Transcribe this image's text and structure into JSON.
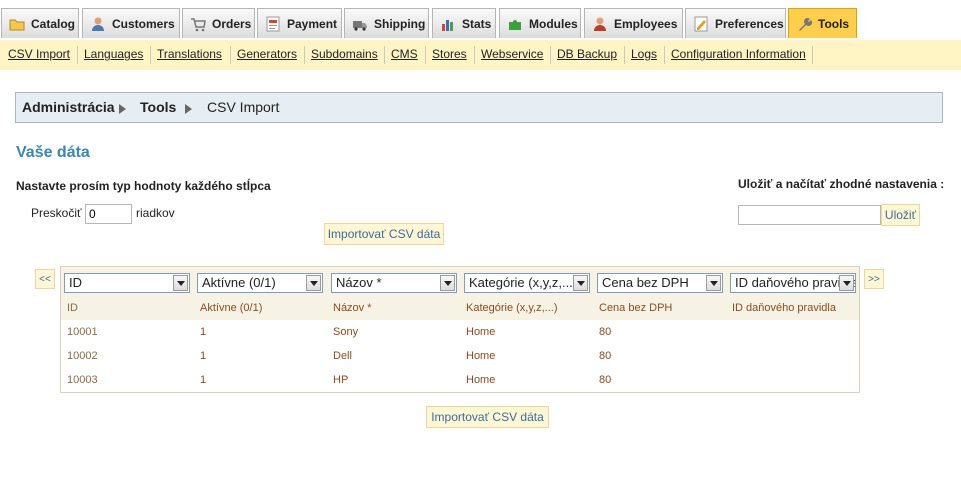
{
  "tabs": [
    {
      "label": "Catalog",
      "icon": "folder-icon"
    },
    {
      "label": "Customers",
      "icon": "user-icon"
    },
    {
      "label": "Orders",
      "icon": "cart-icon"
    },
    {
      "label": "Payment",
      "icon": "payment-icon"
    },
    {
      "label": "Shipping",
      "icon": "truck-icon"
    },
    {
      "label": "Stats",
      "icon": "bar-chart-icon"
    },
    {
      "label": "Modules",
      "icon": "puzzle-icon"
    },
    {
      "label": "Employees",
      "icon": "employee-icon"
    },
    {
      "label": "Preferences",
      "icon": "preferences-icon"
    },
    {
      "label": "Tools",
      "icon": "wrench-icon",
      "active": true
    }
  ],
  "subnav": [
    "CSV Import",
    "Languages",
    "Translations",
    "Generators",
    "Subdomains",
    "CMS",
    "Stores",
    "Webservice",
    "DB Backup",
    "Logs",
    "Configuration Information"
  ],
  "breadcrumb": {
    "root": "Administrácia",
    "section": "Tools",
    "current": "CSV Import"
  },
  "heading": "Vaše dáta",
  "column_type_label": "Nastavte prosím typ hodnoty každého stĺpca",
  "save_settings_label": "Uložiť a načítať zhodné nastavenia :",
  "skip": {
    "prefix": "Preskočiť",
    "value": "0",
    "suffix": "riadkov"
  },
  "save_settings": {
    "value": "",
    "button": "Uložiť"
  },
  "import_button": "Importovať CSV dáta",
  "nav": {
    "prev": "<<",
    "next": ">>"
  },
  "selects": [
    "ID",
    "Aktívne (0/1)",
    "Názov *",
    "Kategórie (x,y,z,...)",
    "Cena bez DPH",
    "ID daňového pravidla"
  ],
  "table": {
    "headers": [
      "ID",
      "Aktívne (0/1)",
      "Názov *",
      "Kategórie (x,y,z,...)",
      "Cena bez DPH",
      "ID daňového pravidla"
    ],
    "rows": [
      [
        "10001",
        "1",
        "Sony",
        "Home",
        "80",
        ""
      ],
      [
        "10002",
        "1",
        "Dell",
        "Home",
        "80",
        ""
      ],
      [
        "10003",
        "1",
        "HP",
        "Home",
        "80",
        ""
      ]
    ]
  },
  "colors": {
    "active_tab": "#ffcf4b",
    "subnav_bg": "#fff4c4",
    "heading": "#3a86b8",
    "link_blue": "#3a6c9e",
    "cell_text": "#8b4b20"
  }
}
